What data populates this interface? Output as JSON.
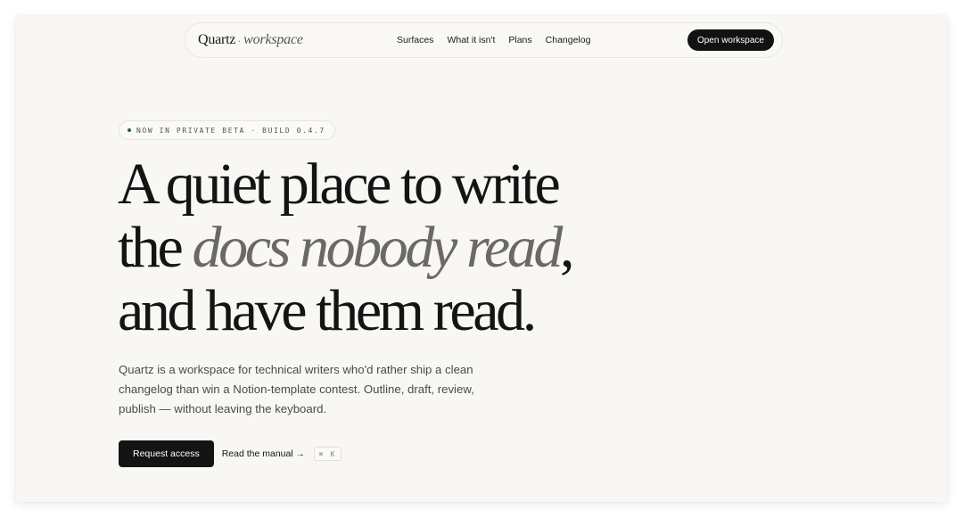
{
  "brand": {
    "name": "Quartz",
    "separator": "·",
    "subtitle": "workspace"
  },
  "nav": {
    "links": [
      "Surfaces",
      "What it isn't",
      "Plans",
      "Changelog"
    ],
    "cta": "Open workspace"
  },
  "badge": {
    "text": "NOW IN PRIVATE BETA · BUILD 0.4.7",
    "dot_color": "#2f5d44"
  },
  "hero": {
    "line1": "A quiet place to write",
    "line2_pre": "the ",
    "line2_em": "docs nobody read",
    "line2_post": ",",
    "line3": "and have them read.",
    "subtext": "Quartz is a workspace for technical writers who'd rather ship a clean changelog than win a Notion-template contest. Outline, draft, review, publish — without leaving the keyboard."
  },
  "actions": {
    "primary": "Request access",
    "secondary": "Read the manual",
    "secondary_arrow": "→",
    "shortcut": "⌘ K"
  },
  "icons": {
    "badge_dot": "status-dot-icon",
    "arrow": "arrow-right-icon"
  },
  "colors": {
    "background": "#f8f7f4",
    "ink": "#141414",
    "muted_em": "#6b6966",
    "button": "#141414"
  }
}
